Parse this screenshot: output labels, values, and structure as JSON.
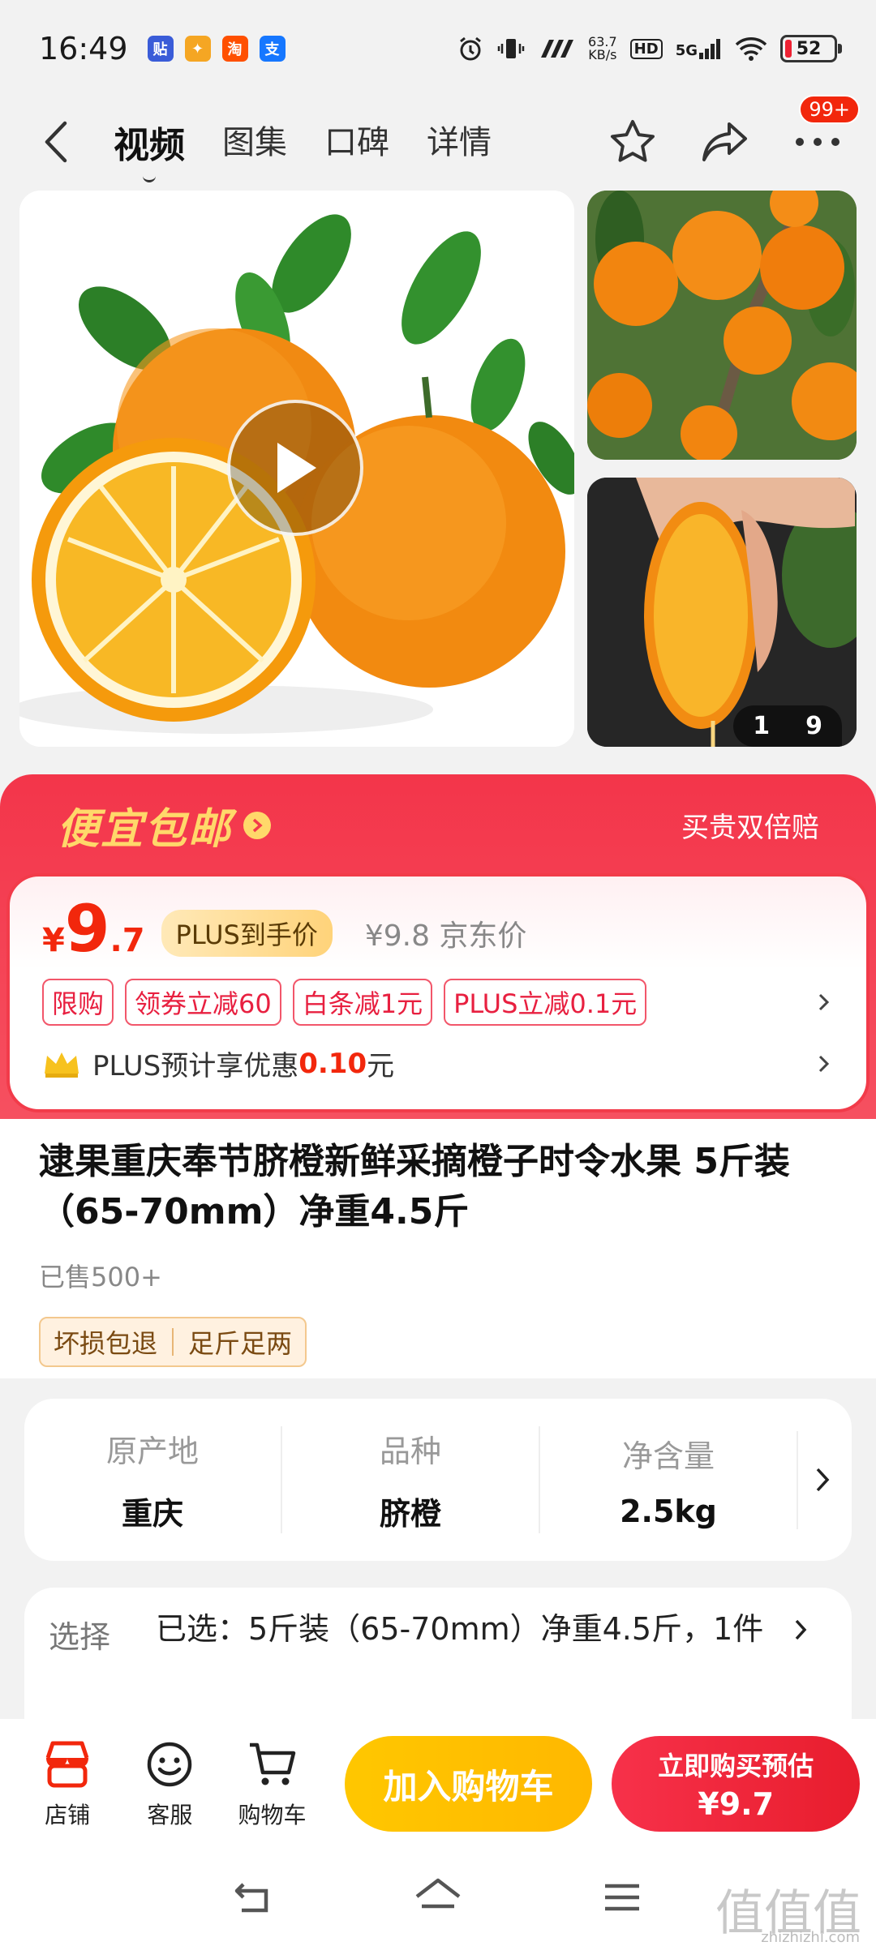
{
  "status_bar": {
    "time": "16:49",
    "net_speed_value": "63.7",
    "net_speed_unit": "KB/s",
    "hd": "HD",
    "network": "5G",
    "battery": "52"
  },
  "status_apps": [
    {
      "glyph": "贴",
      "color": "#3a5cd8"
    },
    {
      "glyph": "✦",
      "color": "#f5a623"
    },
    {
      "glyph": "淘",
      "color": "#ff5000"
    },
    {
      "glyph": "支",
      "color": "#1677ff"
    }
  ],
  "nav": {
    "tabs": [
      "视频",
      "图集",
      "口碑",
      "详情"
    ],
    "badge": "99+"
  },
  "gallery": {
    "page_current": "1",
    "page_total": "9"
  },
  "promo": {
    "title": "便宜包邮",
    "guarantee": "买贵双倍赔",
    "price_symbol": "¥",
    "price_integer": "9",
    "price_decimal": ".7",
    "plus_badge": "PLUS到手价",
    "jd_price": "¥9.8 京东价",
    "tags": [
      "限购",
      "领券立减60",
      "白条减1元",
      "PLUS立减0.1元"
    ],
    "plus_text_prefix": "PLUS预计享优惠",
    "plus_amount": "0.10",
    "plus_text_suffix": "元"
  },
  "product": {
    "title": "逮果重庆奉节脐橙新鲜采摘橙子时令水果 5斤装（65-70mm）净重4.5斤",
    "sold": "已售500+",
    "services": [
      "坏损包退",
      "足斤足两"
    ]
  },
  "specs": [
    {
      "label": "原产地",
      "value": "重庆"
    },
    {
      "label": "品种",
      "value": "脐橙"
    },
    {
      "label": "净含量",
      "value": "2.5kg"
    }
  ],
  "selection": {
    "label": "选择",
    "value": "已选：5斤装（65-70mm）净重4.5斤，1件"
  },
  "action_bar": {
    "shop": "店铺",
    "service": "客服",
    "cart": "购物车",
    "add_to_cart": "加入购物车",
    "buy_now": "立即购买预估",
    "buy_price": "¥9.7"
  },
  "watermark": {
    "logo": "值值值",
    "domain": "zhizhizhi.com"
  },
  "colors": {
    "brand_red": "#f2270c",
    "cart_yellow": "#ffc700",
    "plus_gold": "#ffd37a"
  }
}
